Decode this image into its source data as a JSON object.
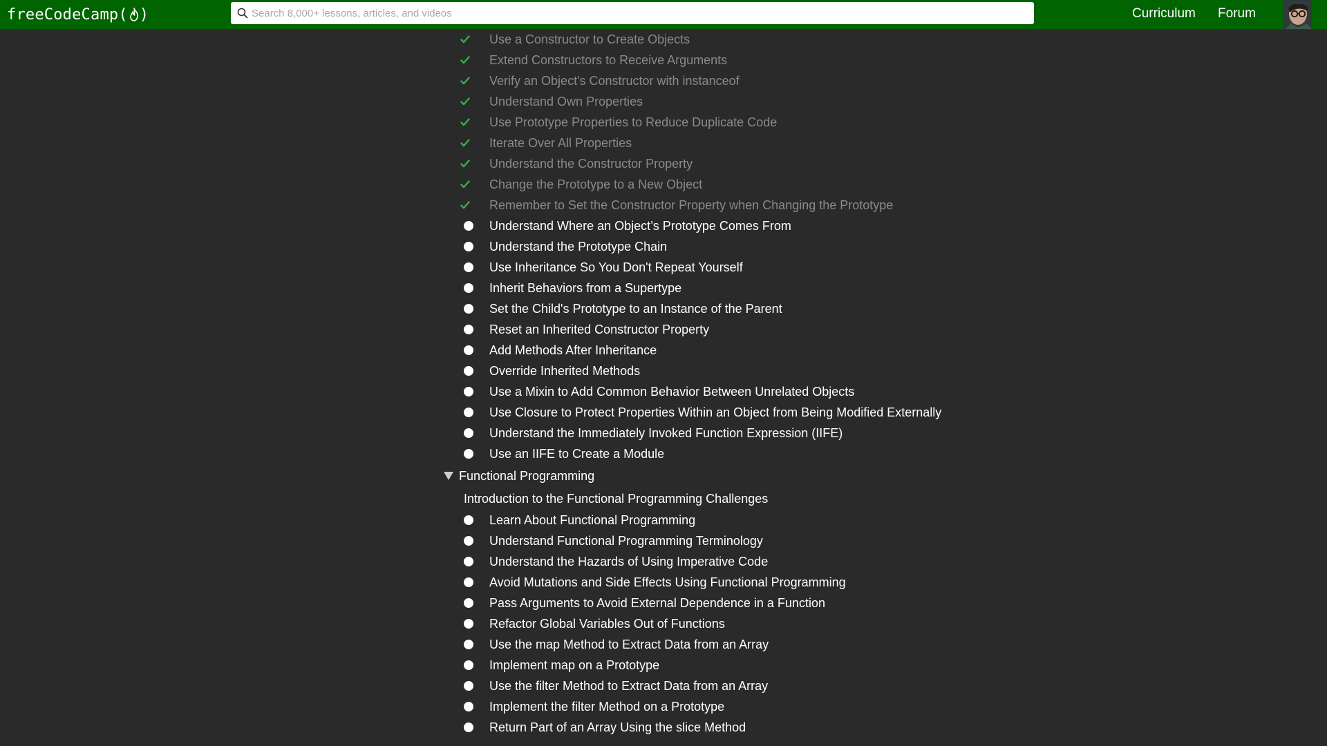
{
  "header": {
    "logo_text": "freeCodeCamp(",
    "logo_close": ")",
    "search_placeholder": "Search 8,000+ lessons, articles, and videos",
    "nav": [
      "Curriculum",
      "Forum"
    ]
  },
  "colors": {
    "navbar": "#006400",
    "background": "#2a2a2a",
    "completed_text": "#8a8a8a",
    "check": "#3cb043"
  },
  "oop": {
    "completed": [
      "Use a Constructor to Create Objects",
      "Extend Constructors to Receive Arguments",
      "Verify an Object's Constructor with instanceof",
      "Understand Own Properties",
      "Use Prototype Properties to Reduce Duplicate Code",
      "Iterate Over All Properties",
      "Understand the Constructor Property",
      "Change the Prototype to a New Object",
      "Remember to Set the Constructor Property when Changing the Prototype"
    ],
    "incomplete": [
      "Understand Where an Object’s Prototype Comes From",
      "Understand the Prototype Chain",
      "Use Inheritance So You Don't Repeat Yourself",
      "Inherit Behaviors from a Supertype",
      "Set the Child's Prototype to an Instance of the Parent",
      "Reset an Inherited Constructor Property",
      "Add Methods After Inheritance",
      "Override Inherited Methods",
      "Use a Mixin to Add Common Behavior Between Unrelated Objects",
      "Use Closure to Protect Properties Within an Object from Being Modified Externally",
      "Understand the Immediately Invoked Function Expression (IIFE)",
      "Use an IIFE to Create a Module"
    ]
  },
  "fp": {
    "section_title": "Functional Programming",
    "intro": "Introduction to the Functional Programming Challenges",
    "items": [
      "Learn About Functional Programming",
      "Understand Functional Programming Terminology",
      "Understand the Hazards of Using Imperative Code",
      "Avoid Mutations and Side Effects Using Functional Programming",
      "Pass Arguments to Avoid External Dependence in a Function",
      "Refactor Global Variables Out of Functions",
      "Use the map Method to Extract Data from an Array",
      "Implement map on a Prototype",
      "Use the filter Method to Extract Data from an Array",
      "Implement the filter Method on a Prototype",
      "Return Part of an Array Using the slice Method"
    ]
  }
}
